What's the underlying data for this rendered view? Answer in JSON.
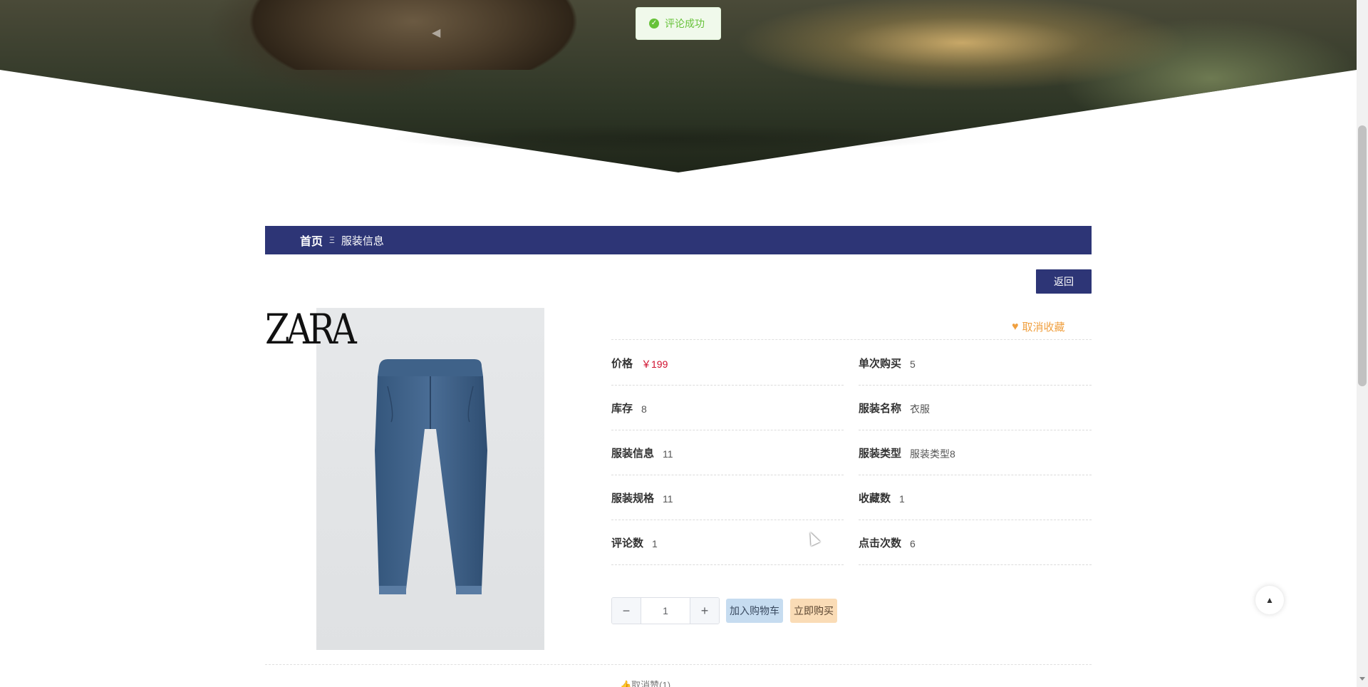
{
  "toast": {
    "message": "评论成功"
  },
  "breadcrumb": {
    "home": "首页",
    "separator": "Ξ",
    "current": "服装信息"
  },
  "back_button": "返回",
  "product": {
    "brand_logo": "ZARA",
    "favorite_label": "取消收藏",
    "details_left": [
      {
        "key": "价格",
        "value": "￥199"
      },
      {
        "key": "库存",
        "value": "8"
      },
      {
        "key": "服装信息",
        "value": "11"
      },
      {
        "key": "服装规格",
        "value": "11"
      },
      {
        "key": "评论数",
        "value": "1"
      }
    ],
    "details_right": [
      {
        "key": "单次购买",
        "value": "5"
      },
      {
        "key": "服装名称",
        "value": "衣服"
      },
      {
        "key": "服装类型",
        "value": "服装类型8"
      },
      {
        "key": "收藏数",
        "value": "1"
      },
      {
        "key": "点击次数",
        "value": "6"
      }
    ]
  },
  "quantity": {
    "minus": "−",
    "value": "1",
    "plus": "+"
  },
  "actions": {
    "add_to_cart": "加入购物车",
    "buy_now": "立即购买"
  },
  "bottom_partial": "👍取消赞(1)",
  "colors": {
    "primary": "#2d3576",
    "price": "#d0102e",
    "favorite": "#f0a040",
    "success": "#67c23a"
  },
  "icons": {
    "toast": "check-circle-icon",
    "favorite": "heart-icon",
    "to_top": "caret-up-icon"
  }
}
